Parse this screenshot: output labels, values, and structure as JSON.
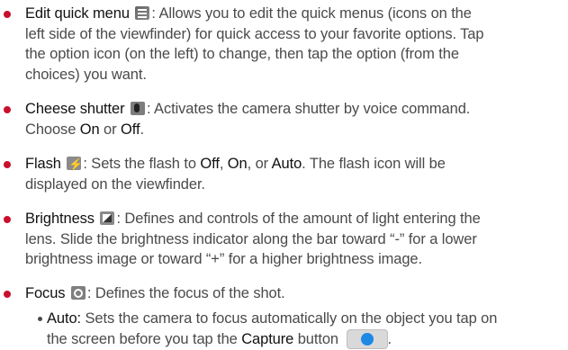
{
  "items": [
    {
      "title": "Edit quick menu",
      "icon": "quick-menu-icon",
      "desc_1": ": Allows you to edit the quick menus (icons on the",
      "desc_2": "left side of the viewfinder) for quick access to your favorite options. Tap",
      "desc_3": "the option icon (on the left) to change, then tap the option (from the",
      "desc_4": "choices) you want."
    },
    {
      "title": "Cheese shutter",
      "icon": "cheese-shutter-icon",
      "desc_1": ": Activates the camera shutter by voice command.",
      "line2_a": "Choose ",
      "opt_on": "On",
      "line2_b": " or ",
      "opt_off": "Off",
      "line2_c": "."
    },
    {
      "title": "Flash",
      "icon": "flash-icon",
      "desc_a": ": Sets the flash to ",
      "opt_off": "Off",
      "comma": ", ",
      "opt_on": "On",
      "or": ", or ",
      "opt_auto": "Auto",
      "desc_b": ". The flash icon will be",
      "desc_2": "displayed on the viewfinder."
    },
    {
      "title": "Brightness",
      "icon": "brightness-icon",
      "desc_1": ": Defines and controls of the amount of light entering the",
      "desc_2": "lens. Slide the brightness indicator along the bar toward “-” for a lower",
      "desc_3": "brightness image or toward “+” for a higher brightness image."
    },
    {
      "title": "Focus",
      "icon": "focus-icon",
      "desc_1": ": Defines the focus of the shot."
    }
  ],
  "sub": {
    "title": "Auto:",
    "desc_1": " Sets the camera to focus automatically on the object you tap on",
    "desc_2_a": "the screen before you tap the ",
    "capture": "Capture",
    "desc_2_b": " button",
    "end": "."
  },
  "colors": {
    "bullet": "#c8102e",
    "text": "#4a4a4a"
  }
}
